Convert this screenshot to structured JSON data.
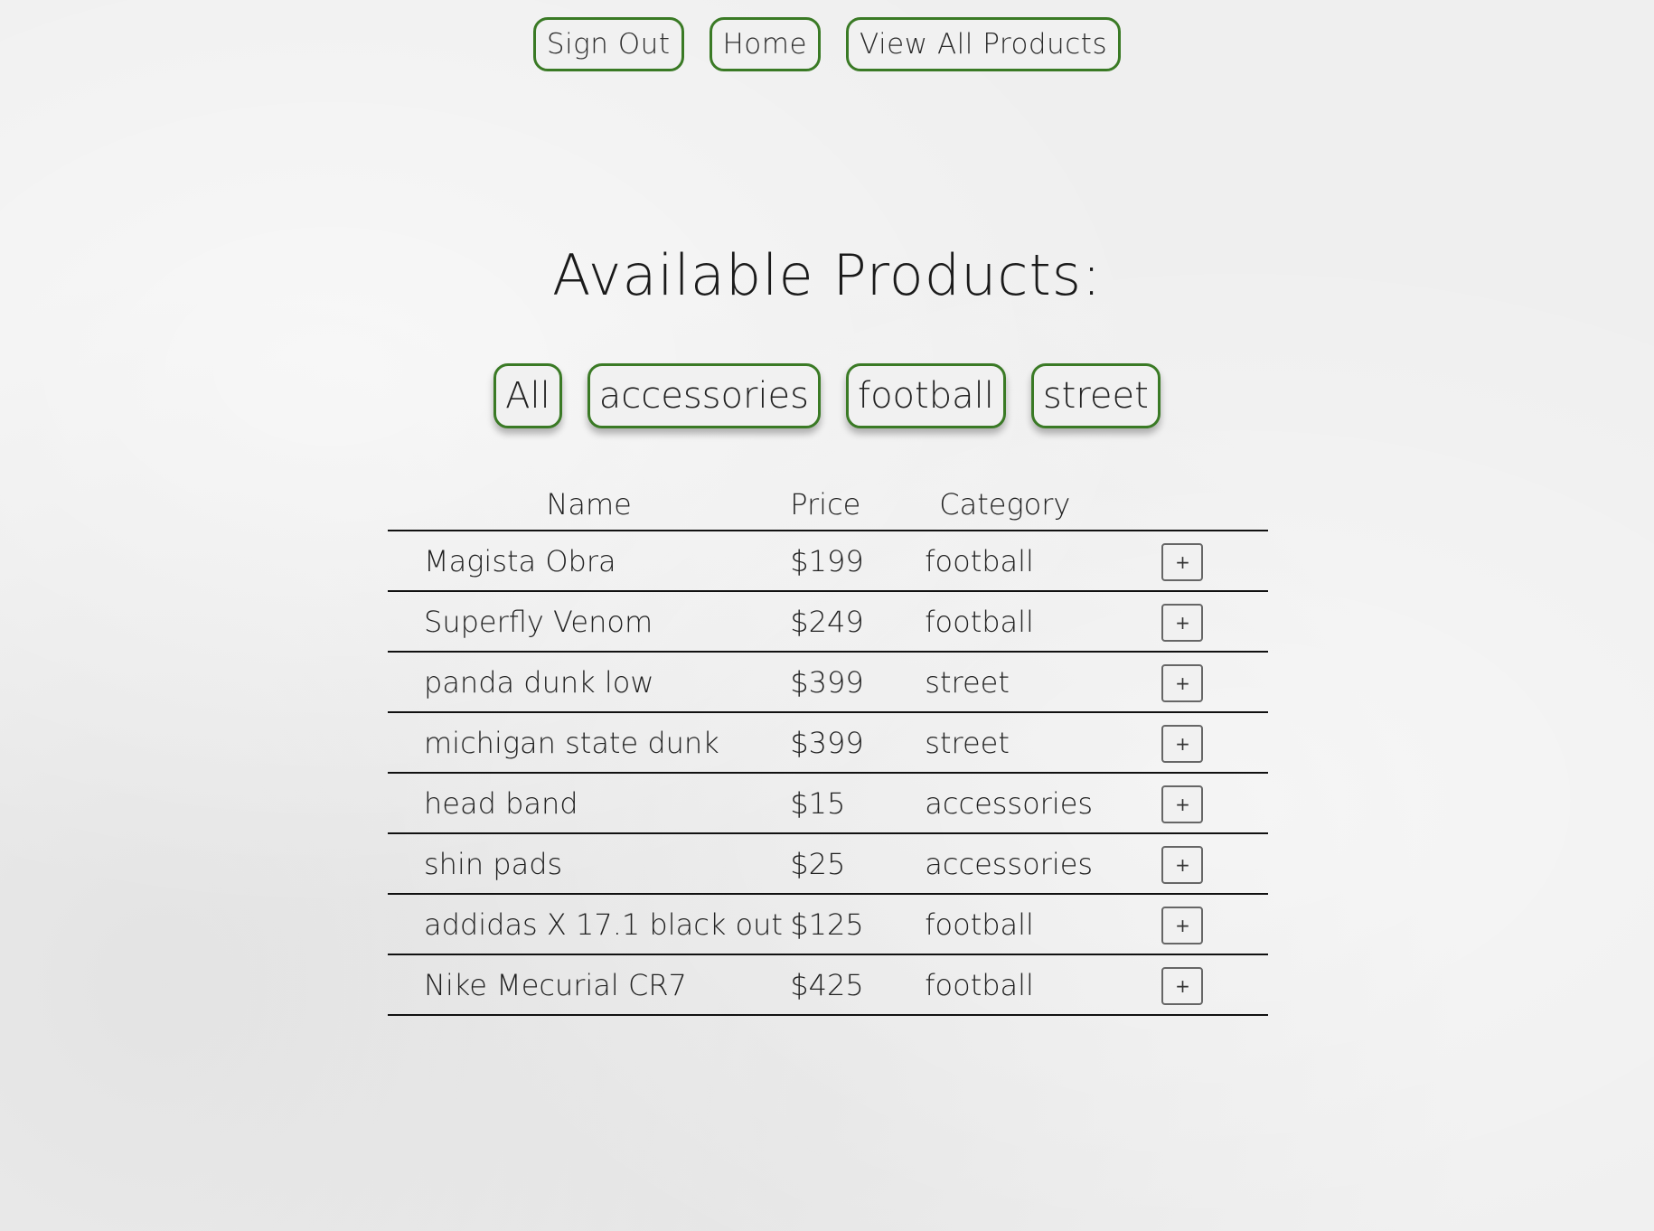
{
  "nav": {
    "sign_out": "Sign Out",
    "home": "Home",
    "view_all": "View All Products"
  },
  "title": "Available Products:",
  "filters": [
    "All",
    "accessories",
    "football",
    "street"
  ],
  "table": {
    "headers": {
      "name": "Name",
      "price": "Price",
      "category": "Category"
    },
    "add_label": "+",
    "rows": [
      {
        "name": "Magista Obra",
        "price": "$199",
        "category": "football"
      },
      {
        "name": "Superfly Venom",
        "price": "$249",
        "category": "football"
      },
      {
        "name": "panda dunk low",
        "price": "$399",
        "category": "street"
      },
      {
        "name": "michigan state dunk",
        "price": "$399",
        "category": "street"
      },
      {
        "name": "head band",
        "price": "$15",
        "category": "accessories"
      },
      {
        "name": "shin pads",
        "price": "$25",
        "category": "accessories"
      },
      {
        "name": "addidas X 17.1 black out",
        "price": "$125",
        "category": "football"
      },
      {
        "name": "Nike Mecurial CR7",
        "price": "$425",
        "category": "football"
      }
    ]
  },
  "colors": {
    "accent_border": "#3a7a25",
    "background": "#efefef",
    "text": "#222222"
  }
}
